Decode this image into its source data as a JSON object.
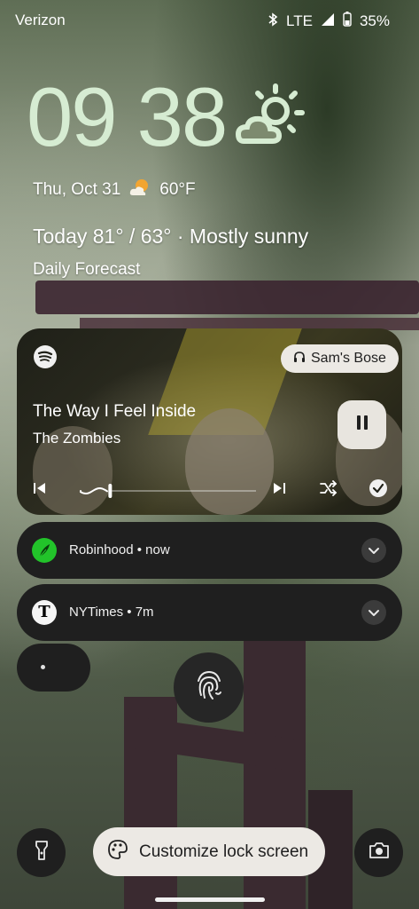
{
  "status_bar": {
    "carrier": "Verizon",
    "network": "LTE",
    "battery": "35%",
    "icons": [
      "bluetooth-icon",
      "signal-icon",
      "battery-icon"
    ]
  },
  "clock": {
    "time": "09 38",
    "weather_icon": "sun-cloud-icon"
  },
  "date_weather": {
    "date": "Thu, Oct 31",
    "temp": "60°F",
    "weather_icon": "partly-sunny-icon"
  },
  "forecast": {
    "today": "Today 81° / 63° · Mostly sunny",
    "daily_label": "Daily Forecast"
  },
  "media": {
    "app_icon": "spotify-icon",
    "output_device": "Sam's Bose",
    "title": "The Way I Feel Inside",
    "artist": "The Zombies",
    "progress": 0.16,
    "controls": [
      "previous-icon",
      "next-icon",
      "shuffle-icon",
      "check-icon"
    ],
    "play_state": "paused-icon"
  },
  "notifications": [
    {
      "app": "Robinhood",
      "time": "now",
      "label": "Robinhood • now",
      "icon": "robinhood-feather-icon"
    },
    {
      "app": "NYTimes",
      "time": "7m",
      "label": "NYTimes • 7m",
      "icon": "nyt-icon",
      "icon_letter": "T"
    }
  ],
  "bottom": {
    "customize_label": "Customize lock screen",
    "left_shortcut": "flashlight-icon",
    "right_shortcut": "camera-icon",
    "center_icon": "fingerprint-icon"
  },
  "colors": {
    "clock": "#d6ecd2",
    "robinhood": "#22c32a",
    "card": "#1f1f1f",
    "chip": "#ece9e4"
  }
}
